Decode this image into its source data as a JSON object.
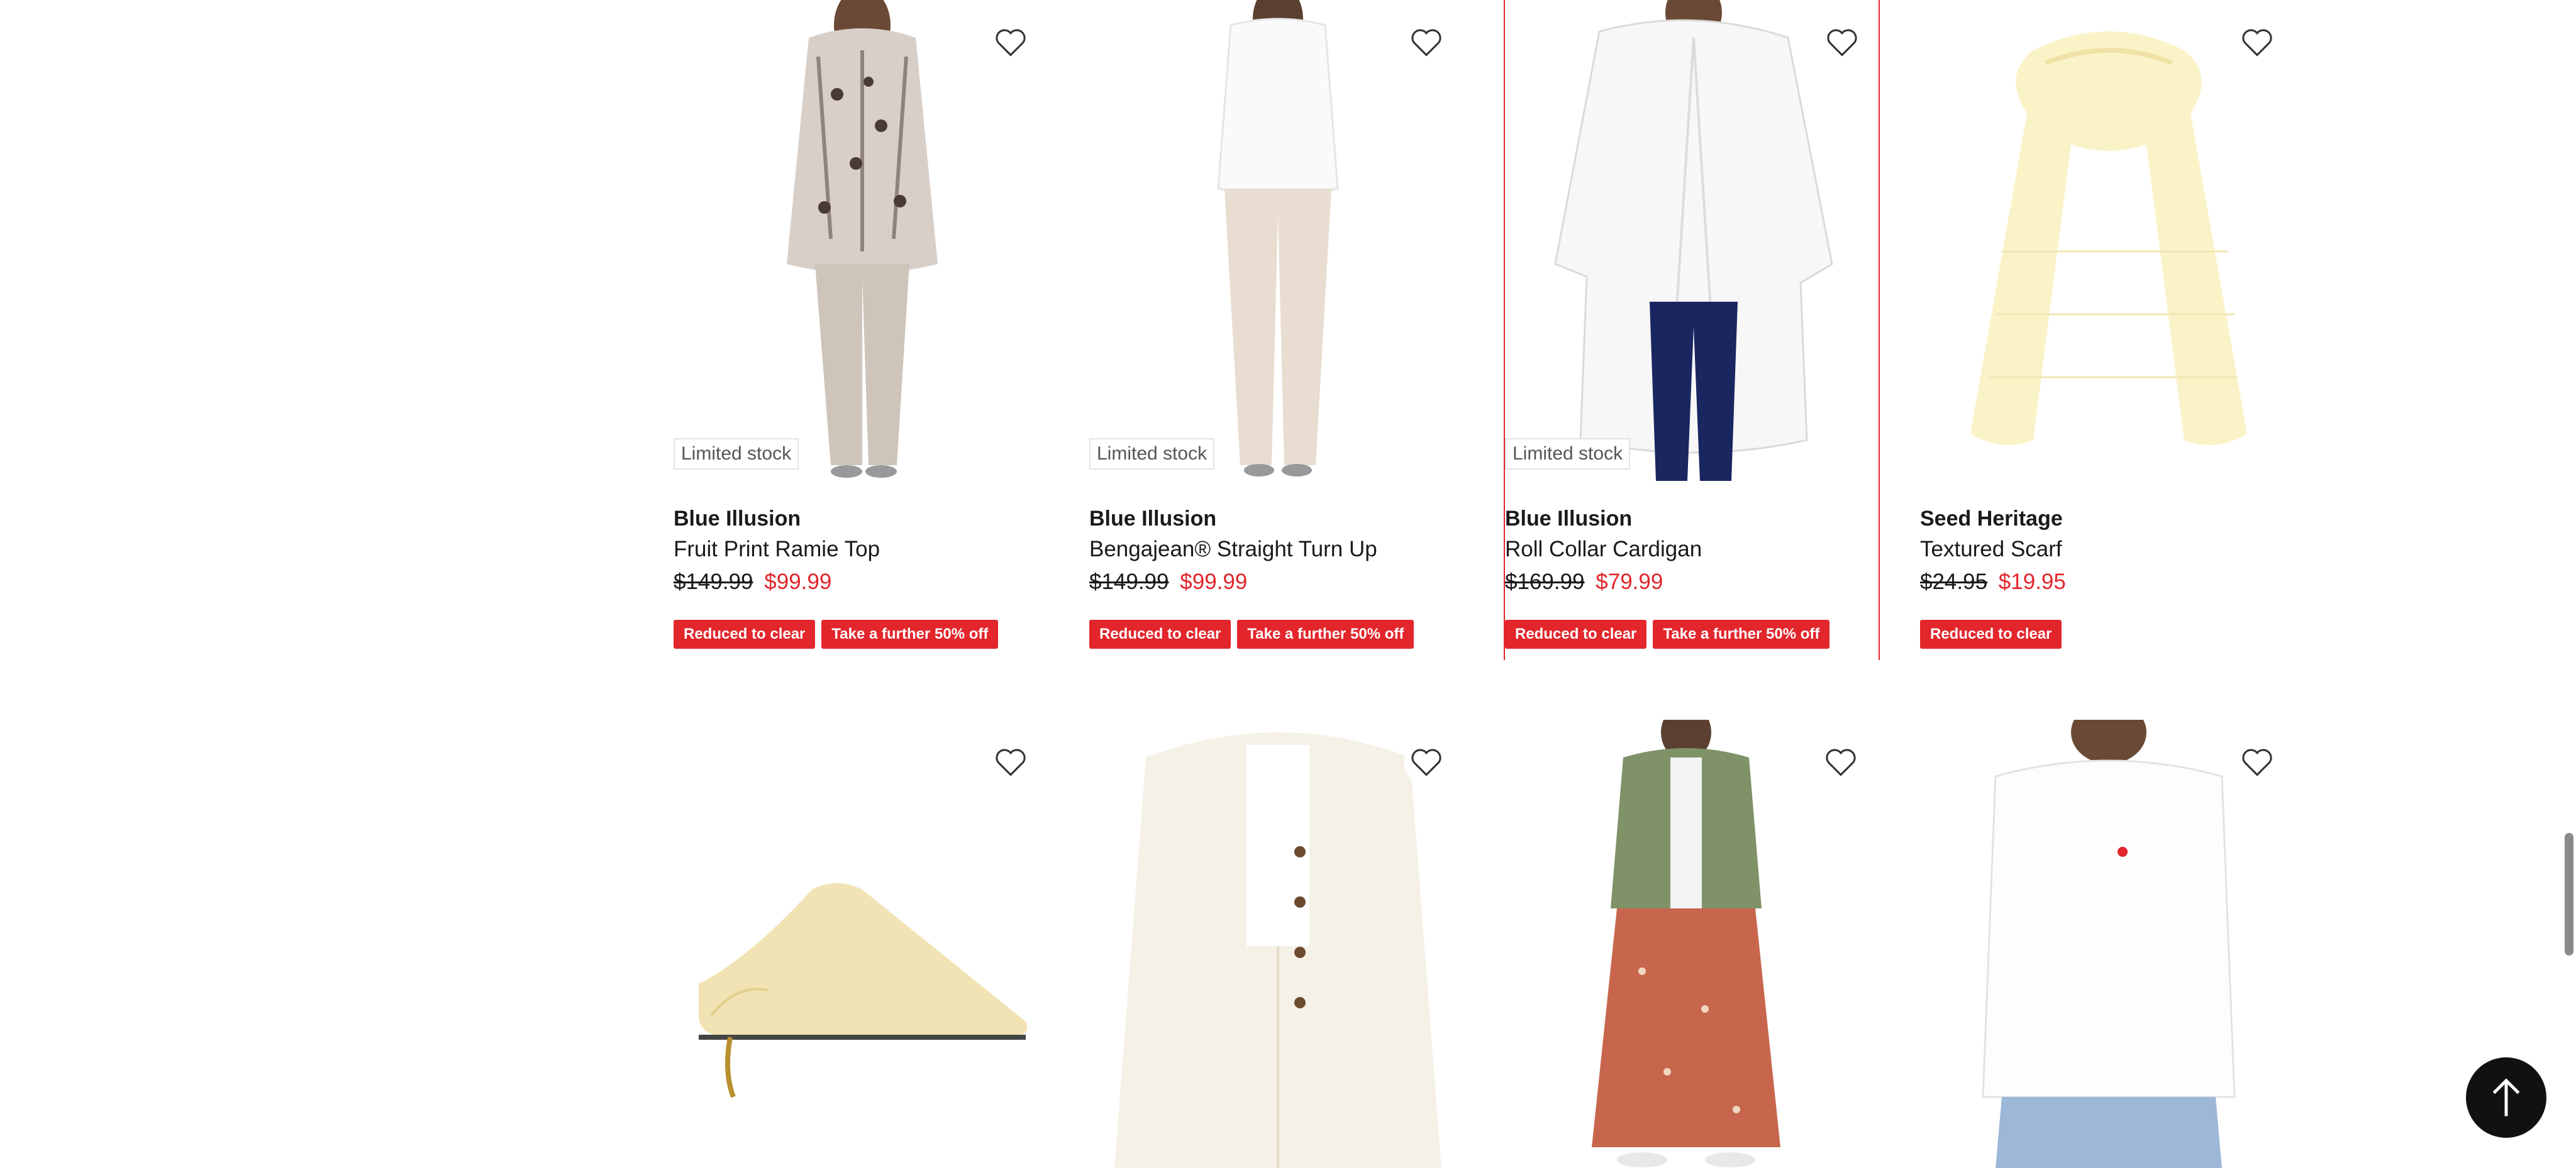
{
  "products": [
    {
      "brand": "Blue Illusion",
      "name": "Fruit Print Ramie Top",
      "was_price": "$149.99",
      "now_price": "$99.99",
      "stock": "Limited stock",
      "tags": [
        "Reduced to clear",
        "Take a further 50% off"
      ],
      "image": "woman-in-print-top-and-beige-pants"
    },
    {
      "brand": "Blue Illusion",
      "name": "Bengajean® Straight Turn Up",
      "was_price": "$149.99",
      "now_price": "$99.99",
      "stock": "Limited stock",
      "tags": [
        "Reduced to clear",
        "Take a further 50% off"
      ],
      "image": "woman-in-white-tee-and-cream-pants"
    },
    {
      "brand": "Blue Illusion",
      "name": "Roll Collar Cardigan",
      "was_price": "$169.99",
      "now_price": "$79.99",
      "stock": "Limited stock",
      "tags": [
        "Reduced to clear",
        "Take a further 50% off"
      ],
      "image": "woman-in-white-cardigan"
    },
    {
      "brand": "Seed Heritage",
      "name": "Textured Scarf",
      "was_price": "$24.95",
      "now_price": "$19.95",
      "stock": "",
      "tags": [
        "Reduced to clear"
      ],
      "image": "yellow-scarf"
    },
    {
      "image": "yellow-mule-heel"
    },
    {
      "image": "cream-quilted-jacket"
    },
    {
      "image": "green-jacket-floral-skirt"
    },
    {
      "image": "white-tee-jeans"
    }
  ],
  "colors": {
    "accent": "#e2262c",
    "text": "#1a1a1a",
    "back_to_top_bg": "#111111"
  },
  "icons": {
    "wishlist": "heart-outline-icon",
    "back_to_top": "arrow-up-icon"
  }
}
